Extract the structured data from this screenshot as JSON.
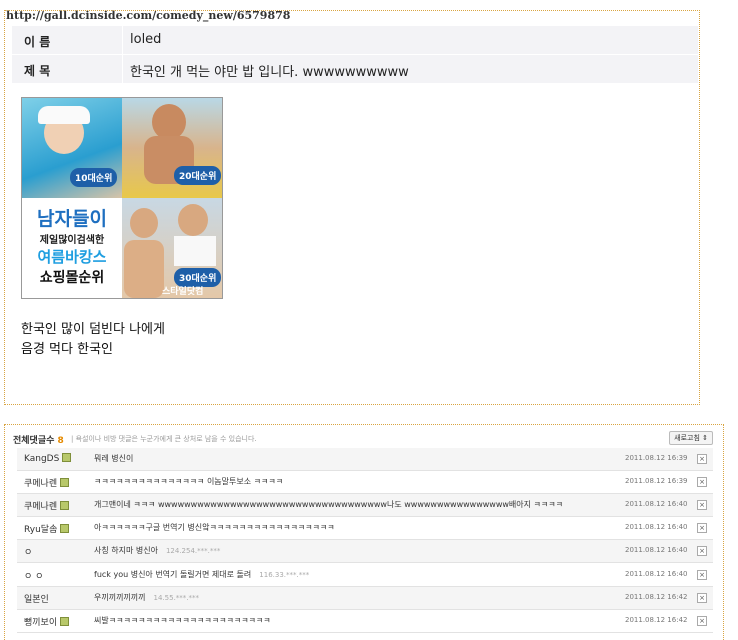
{
  "url": "http://gall.dcinside.com/comedy_new/6579878",
  "post": {
    "name_label": "이 름",
    "name_value": "loled",
    "title_label": "제 목",
    "title_value": "한국인 개 먹는 야만 밥 입니다. wwwwwwwwww",
    "ad": {
      "badges": [
        "10대순위",
        "20대순위",
        "30대순위"
      ],
      "line1": "남자들이",
      "line2": "제일많이검색한",
      "line3": "여름바캉스",
      "line4": "쇼핑몰순위",
      "corner": "스타일닷컴"
    },
    "body_lines": [
      "한국인 많이 덤빈다 나에게",
      "음경 먹다 한국인"
    ]
  },
  "comments": {
    "header_label": "전체댓글수",
    "count": "8",
    "note": "| 욕설이나 비방 댓글은 누군가에게 큰 상처로 남을 수 있습니다.",
    "refresh_label": "새로고침",
    "delete_symbol": "×",
    "rows": [
      {
        "nick": "KangDS",
        "gallog": true,
        "text": "뭐레 병신이",
        "ip": "",
        "date": "2011.08.12 16:39"
      },
      {
        "nick": "쿠메나렌",
        "gallog": true,
        "text": "ㅋㅋㅋㅋㅋㅋㅋㅋㅋㅋㅋㅋㅋㅋㅋ 이놈말투보소 ㅋㅋㅋㅋ",
        "ip": "",
        "date": "2011.08.12 16:39"
      },
      {
        "nick": "쿠메나렌",
        "gallog": true,
        "text": "개그맨이네 ㅋㅋㅋ wwwwwwwwwwwwwwwwwwwwwwwwwwwwwwwwwww나도 wwwwwwwwwwwwwwww배아지 ㅋㅋㅋㅋ",
        "ip": "",
        "date": "2011.08.12 16:40"
      },
      {
        "nick": "Ryu달솜",
        "gallog": true,
        "text": "아ㅋㅋㅋㅋㅋㅋ구글 번역기 병신앜ㅋㅋㅋㅋㅋㅋㅋㅋㅋㅋㅋㅋㅋㅋㅋㅋㅋ",
        "ip": "",
        "date": "2011.08.12 16:40"
      },
      {
        "nick": "ㅇ",
        "gallog": false,
        "text": "사칭 하지마 병신아",
        "ip": "124.254.***.***",
        "date": "2011.08.12 16:40"
      },
      {
        "nick": "ㅇ ㅇ",
        "gallog": false,
        "text": "fuck you 병신아 번역기 돌릴거면 제대로 돌려",
        "ip": "116.33.***.***",
        "date": "2011.08.12 16:40"
      },
      {
        "nick": "일본인",
        "gallog": false,
        "text": "우끼끼끼끼끼끼",
        "ip": "14.55.***.***",
        "date": "2011.08.12 16:42"
      },
      {
        "nick": "뻥끼보이",
        "gallog": true,
        "text": "씨발ㅋㅋㅋㅋㅋㅋㅋㅋㅋㅋㅋㅋㅋㅋㅋㅋㅋㅋㅋㅋㅋㅋ",
        "ip": "",
        "date": "2011.08.12 16:42"
      }
    ]
  }
}
